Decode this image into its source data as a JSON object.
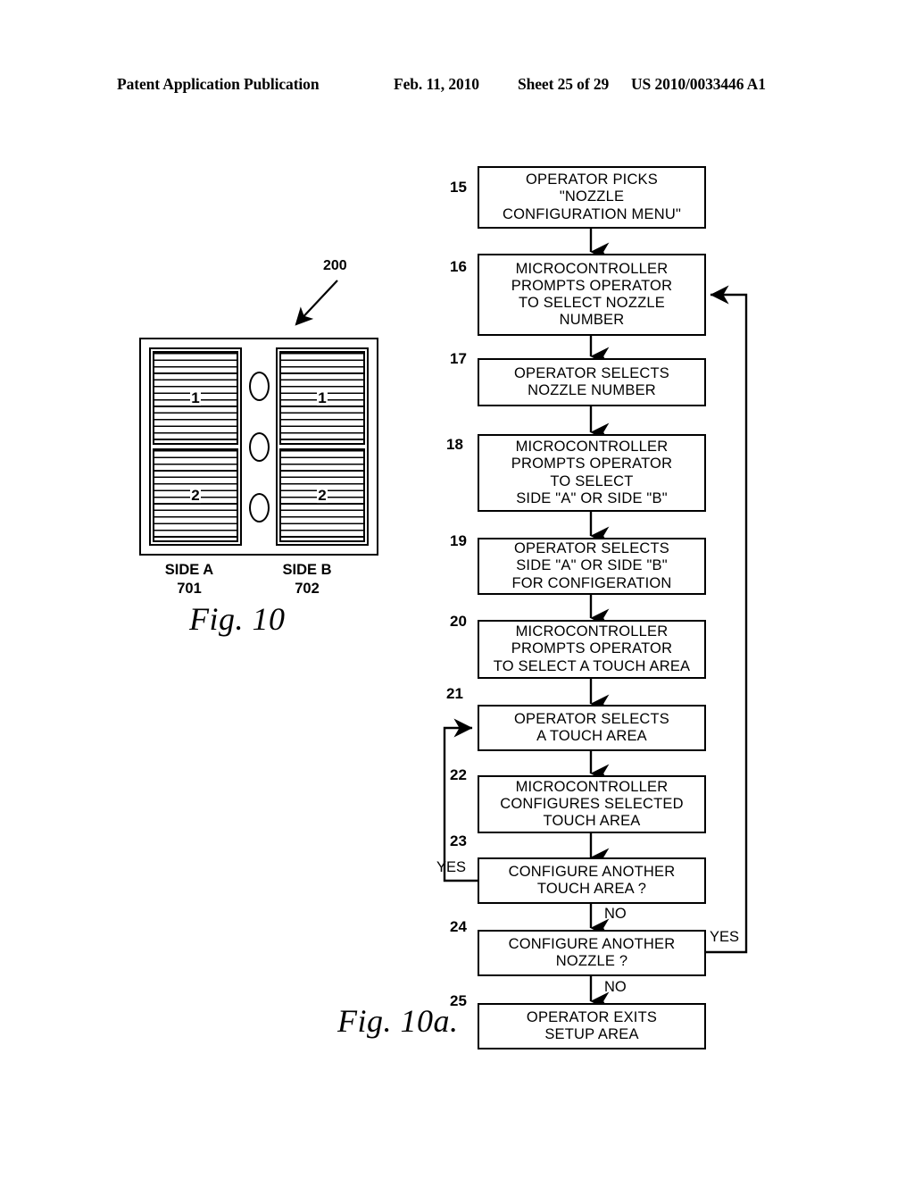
{
  "header": {
    "publication": "Patent Application Publication",
    "date": "Feb. 11, 2010",
    "sheet": "Sheet 25 of 29",
    "patent_number": "US 2010/0033446 A1"
  },
  "figure_10": {
    "caption": "Fig. 10",
    "ref_200": "200",
    "side_a": {
      "name": "SIDE A",
      "ref": "701"
    },
    "side_b": {
      "name": "SIDE B",
      "ref": "702"
    },
    "cells": {
      "a_top": "1",
      "a_bottom": "2",
      "b_top": "1",
      "b_bottom": "2"
    }
  },
  "figure_10a": {
    "caption": "Fig. 10a.",
    "boxes": [
      {
        "ref": "15",
        "text": "OPERATOR PICKS\n\"NOZZLE\nCONFIGURATION MENU\""
      },
      {
        "ref": "16",
        "text": "MICROCONTROLLER\nPROMPTS OPERATOR\nTO SELECT NOZZLE\nNUMBER"
      },
      {
        "ref": "17",
        "text": "OPERATOR SELECTS\nNOZZLE NUMBER"
      },
      {
        "ref": "18",
        "text": "MICROCONTROLLER\nPROMPTS OPERATOR\nTO SELECT\nSIDE \"A\" OR SIDE \"B\""
      },
      {
        "ref": "19",
        "text": "OPERATOR SELECTS\nSIDE \"A\" OR SIDE \"B\"\nFOR CONFIGERATION"
      },
      {
        "ref": "20",
        "text": "MICROCONTROLLER\nPROMPTS OPERATOR\nTO SELECT  A TOUCH AREA"
      },
      {
        "ref": "21",
        "text": "OPERATOR SELECTS\nA TOUCH AREA"
      },
      {
        "ref": "22",
        "text": "MICROCONTROLLER\nCONFIGURES SELECTED\nTOUCH AREA"
      },
      {
        "ref": "23",
        "text": "CONFIGURE ANOTHER\nTOUCH AREA ?"
      },
      {
        "ref": "24",
        "text": "CONFIGURE ANOTHER\nNOZZLE ?"
      },
      {
        "ref": "25",
        "text": "OPERATOR EXITS\nSETUP AREA"
      }
    ],
    "branch_labels": {
      "yes_touch_area": "YES",
      "no_touch_area": "NO",
      "yes_nozzle": "YES",
      "no_nozzle": "NO"
    }
  }
}
